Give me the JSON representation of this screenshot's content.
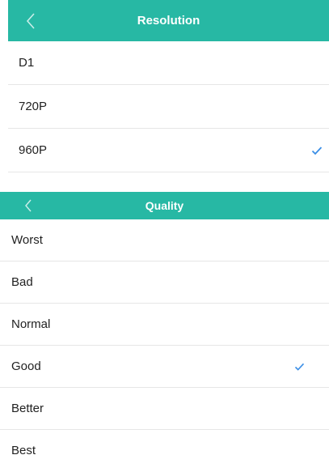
{
  "resolution": {
    "title": "Resolution",
    "back_icon": "chevron-left-icon",
    "selected": "960P",
    "items": [
      {
        "label": "D1",
        "checked": false
      },
      {
        "label": "720P",
        "checked": false
      },
      {
        "label": "960P",
        "checked": true
      }
    ]
  },
  "quality": {
    "title": "Quality",
    "back_icon": "chevron-left-icon",
    "selected": "Good",
    "items": [
      {
        "label": "Worst",
        "checked": false
      },
      {
        "label": "Bad",
        "checked": false
      },
      {
        "label": "Normal",
        "checked": false
      },
      {
        "label": "Good",
        "checked": true
      },
      {
        "label": "Better",
        "checked": false
      },
      {
        "label": "Best",
        "checked": false
      }
    ]
  },
  "colors": {
    "header_bg": "#27b8a4",
    "header_text": "#ffffff",
    "check": "#3a8ee6",
    "divider": "#e6e6e6"
  }
}
